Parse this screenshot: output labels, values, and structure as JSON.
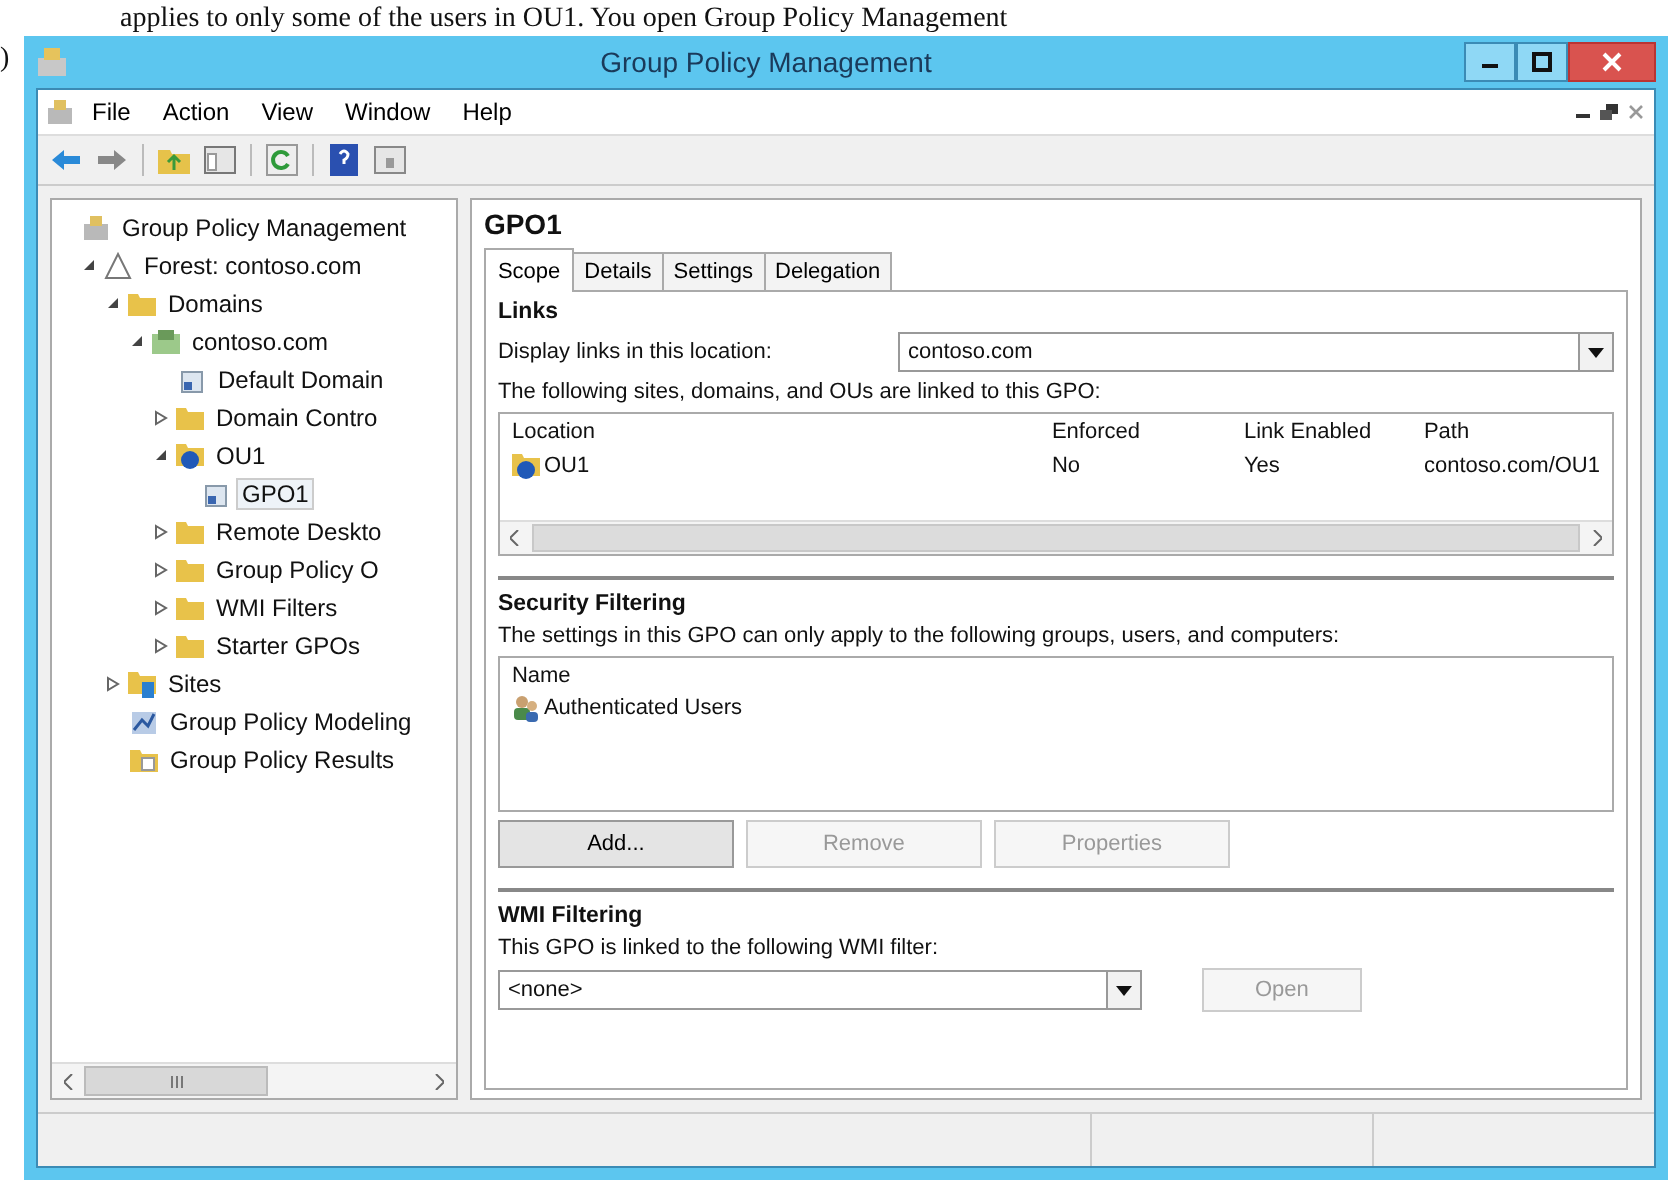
{
  "page_text": {
    "top_line": "applies to only some of the users in OU1. You open Group Policy Management",
    "side_mark": ")"
  },
  "window": {
    "title": "Group Policy Management"
  },
  "menu": [
    "File",
    "Action",
    "View",
    "Window",
    "Help"
  ],
  "tree": [
    {
      "label": "Group Policy Management",
      "kind": "root",
      "selected": false,
      "children": [
        {
          "label": "Forest: contoso.com",
          "kind": "forest",
          "expanded": true,
          "selected": false,
          "children": [
            {
              "label": "Domains",
              "kind": "folder",
              "expanded": true,
              "selected": false,
              "children": [
                {
                  "label": "contoso.com",
                  "kind": "domain",
                  "expanded": true,
                  "selected": false,
                  "children": [
                    {
                      "label": "Default Domain",
                      "kind": "gpo",
                      "selected": false
                    },
                    {
                      "label": "Domain Contro",
                      "kind": "folder",
                      "expanded": false,
                      "selected": false
                    },
                    {
                      "label": "OU1",
                      "kind": "ou",
                      "expanded": true,
                      "selected": false,
                      "children": [
                        {
                          "label": "GPO1",
                          "kind": "gpo",
                          "selected": true
                        }
                      ]
                    },
                    {
                      "label": "Remote Deskto",
                      "kind": "folder",
                      "expanded": false,
                      "selected": false
                    },
                    {
                      "label": "Group Policy O",
                      "kind": "folder",
                      "expanded": false,
                      "selected": false
                    },
                    {
                      "label": "WMI Filters",
                      "kind": "folder",
                      "expanded": false,
                      "selected": false
                    },
                    {
                      "label": "Starter GPOs",
                      "kind": "folder",
                      "expanded": false,
                      "selected": false
                    }
                  ]
                }
              ]
            },
            {
              "label": "Sites",
              "kind": "sites",
              "expanded": false,
              "selected": false
            },
            {
              "label": "Group Policy Modeling",
              "kind": "modeling",
              "selected": false
            },
            {
              "label": "Group Policy Results",
              "kind": "results",
              "selected": false
            }
          ]
        }
      ]
    }
  ],
  "details": {
    "title": "GPO1",
    "tabs": [
      {
        "label": "Scope",
        "selected": true
      },
      {
        "label": "Details",
        "selected": false
      },
      {
        "label": "Settings",
        "selected": false
      },
      {
        "label": "Delegation",
        "selected": false
      }
    ],
    "links": {
      "heading": "Links",
      "location_label": "Display links in this location:",
      "location_value": "contoso.com",
      "caption": "The following sites, domains, and OUs are linked to this GPO:",
      "columns": [
        "Location",
        "Enforced",
        "Link Enabled",
        "Path"
      ],
      "rows": [
        {
          "location": "OU1",
          "enforced": "No",
          "link_enabled": "Yes",
          "path": "contoso.com/OU1"
        }
      ]
    },
    "security": {
      "heading": "Security Filtering",
      "caption": "The settings in this GPO can only apply to the following groups, users, and computers:",
      "column": "Name",
      "items": [
        "Authenticated Users"
      ],
      "buttons": [
        {
          "label": "Add...",
          "disabled": false
        },
        {
          "label": "Remove",
          "disabled": true
        },
        {
          "label": "Properties",
          "disabled": true
        }
      ]
    },
    "wmi": {
      "heading": "WMI Filtering",
      "caption": "This GPO is linked to the following WMI filter:",
      "value": "<none>",
      "button": {
        "label": "Open",
        "disabled": true
      }
    }
  }
}
